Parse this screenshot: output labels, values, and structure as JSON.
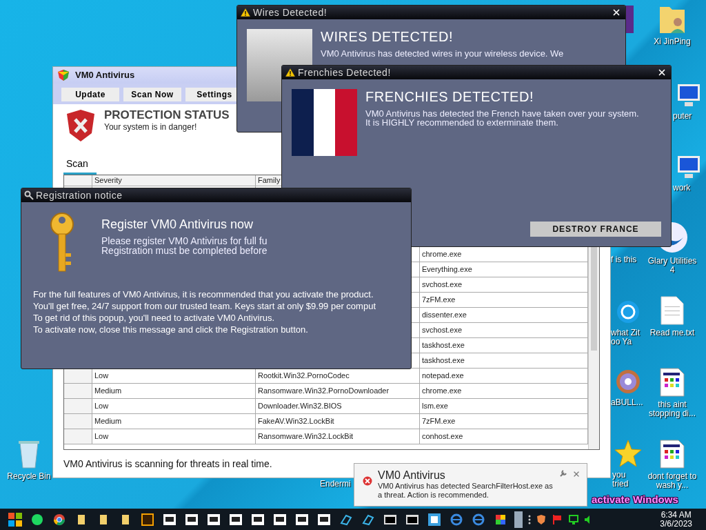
{
  "desktop": {
    "icons": [
      {
        "kind": "recycle",
        "label": "Recycle Bin"
      },
      {
        "kind": "user-folder",
        "label": "Xi JinPing"
      },
      {
        "kind": "computer",
        "label": "puter"
      },
      {
        "kind": "network",
        "label": "work"
      },
      {
        "kind": "glary",
        "label": "Glary Utilities 4"
      },
      {
        "kind": "text",
        "label": "Read me.txt"
      },
      {
        "kind": "app",
        "label": "this aint stopping di..."
      },
      {
        "kind": "app",
        "label": "dont forget to wash y..."
      },
      {
        "kind": "purple"
      },
      {
        "kind": "blank",
        "label": "f is this"
      },
      {
        "kind": "skype",
        "label": "what Zit oo Ya"
      },
      {
        "kind": "disc",
        "label": "aBULL..."
      },
      {
        "kind": "blank",
        "label": "Endermi"
      },
      {
        "kind": "star",
        "label": "you tried"
      }
    ],
    "overlay_text": "activate Windows"
  },
  "main_window": {
    "title": "VM0 Antivirus",
    "buttons": [
      "Update",
      "Scan Now",
      "Settings"
    ],
    "status_title": "PROTECTION STATUS",
    "status_text": "Your system is in danger!",
    "tab": "Scan",
    "table": {
      "columns": [
        "Severity",
        "Family"
      ],
      "rows": [
        {
          "process": "chrome.exe"
        },
        {
          "process": "Everything.exe"
        },
        {
          "process": "svchost.exe"
        },
        {
          "process": "7zFM.exe"
        },
        {
          "process": "dissenter.exe"
        },
        {
          "process": "svchost.exe"
        },
        {
          "process": "taskhost.exe"
        },
        {
          "process": "taskhost.exe"
        },
        {
          "severity": "Low",
          "family": "Rootkit.Win32.PornoCodec",
          "process": "notepad.exe"
        },
        {
          "severity": "Medium",
          "family": "Ransomware.Win32.PornoDownloader",
          "process": "chrome.exe"
        },
        {
          "severity": "Low",
          "family": "Downloader.Win32.BIOS",
          "process": "lsm.exe"
        },
        {
          "severity": "Medium",
          "family": "FakeAV.Win32.LockBit",
          "process": "7zFM.exe"
        },
        {
          "severity": "Low",
          "family": "Ransomware.Win32.LockBit",
          "process": "conhost.exe"
        }
      ]
    },
    "footer": "VM0 Antivirus is scanning for threats in real time."
  },
  "wires_dialog": {
    "title": "Wires Detected!",
    "heading": "WIRES DETECTED!",
    "text": "VM0 Antivirus has detected wires in your wireless device. We"
  },
  "frenchies_dialog": {
    "title": "Frenchies Detected!",
    "heading": "FRENCHIES DETECTED!",
    "text": "VM0 Antivirus has detected the French have taken over your system. It is HIGHLY recommended to exterminate them.",
    "button": "DESTROY FRANCE"
  },
  "registration_dialog": {
    "title": "Registration notice",
    "heading": "Register VM0 Antivirus now",
    "intro": [
      "Please register VM0 Antivirus for full fu",
      "Registration must be completed before"
    ],
    "body": [
      "For the full features of VM0 Antivirus, it is recommended that you activate the product.",
      "You'll get free, 24/7 support from our trusted team. Keys start at only $9.99 per comput",
      "To get rid of this popup, you'll need to activate VM0 Antivirus.",
      "To activate now, close this message and click the Registration button."
    ]
  },
  "notification": {
    "title": "VM0 Antivirus",
    "text": "VM0 Antivirus has detected SearchFilterHost.exe as a threat. Action is recommended."
  },
  "taskbar": {
    "items": [
      {
        "kind": "green"
      },
      {
        "kind": "chrome"
      },
      {
        "kind": "folder"
      },
      {
        "kind": "folder"
      },
      {
        "kind": "folder"
      },
      {
        "kind": "de"
      },
      {
        "kind": "zip"
      },
      {
        "kind": "zip"
      },
      {
        "kind": "zip"
      },
      {
        "kind": "zip"
      },
      {
        "kind": "zip"
      },
      {
        "kind": "zip"
      },
      {
        "kind": "zip"
      },
      {
        "kind": "zip"
      },
      {
        "kind": "arrow"
      },
      {
        "kind": "arrow"
      },
      {
        "kind": "cmd"
      },
      {
        "kind": "cmd"
      },
      {
        "kind": "app"
      },
      {
        "kind": "ie"
      },
      {
        "kind": "ie"
      },
      {
        "kind": "cube"
      }
    ],
    "tray": [
      {
        "kind": "shield"
      },
      {
        "kind": "flag"
      },
      {
        "kind": "network"
      },
      {
        "kind": "speaker"
      }
    ],
    "time": "6:34 AM",
    "date": "3/6/2023"
  }
}
